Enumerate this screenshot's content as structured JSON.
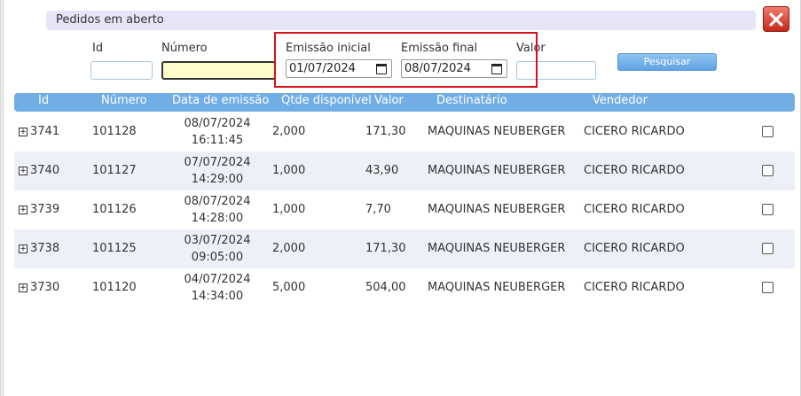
{
  "dialog": {
    "title": "Pedidos em aberto"
  },
  "filters": {
    "id_label": "Id",
    "numero_label": "Número",
    "emissao_inicial_label": "Emissão inicial",
    "emissao_inicial_value": "01/07/2024",
    "emissao_final_label": "Emissão final",
    "emissao_final_value": "08/07/2024",
    "valor_label": "Valor",
    "search_label": "Pesquisar"
  },
  "table": {
    "headers": [
      "Id",
      "Número",
      "Data de emissão",
      "Qtde disponível",
      "Valor",
      "Destinatário",
      "Vendedor"
    ],
    "rows": [
      {
        "id": "3741",
        "numero": "101128",
        "date": "08/07/2024",
        "time": "16:11:45",
        "qtde": "2,000",
        "valor": "171,30",
        "destinatario": "MAQUINAS NEUBERGER",
        "vendedor": "CICERO RICARDO"
      },
      {
        "id": "3740",
        "numero": "101127",
        "date": "07/07/2024",
        "time": "14:29:00",
        "qtde": "1,000",
        "valor": "43,90",
        "destinatario": "MAQUINAS NEUBERGER",
        "vendedor": "CICERO RICARDO"
      },
      {
        "id": "3739",
        "numero": "101126",
        "date": "08/07/2024",
        "time": "14:28:00",
        "qtde": "1,000",
        "valor": "7,70",
        "destinatario": "MAQUINAS NEUBERGER",
        "vendedor": "CICERO RICARDO"
      },
      {
        "id": "3738",
        "numero": "101125",
        "date": "03/07/2024",
        "time": "09:05:00",
        "qtde": "2,000",
        "valor": "171,30",
        "destinatario": "MAQUINAS NEUBERGER",
        "vendedor": "CICERO RICARDO"
      },
      {
        "id": "3730",
        "numero": "101120",
        "date": "04/07/2024",
        "time": "14:34:00",
        "qtde": "5,000",
        "valor": "504,00",
        "destinatario": "MAQUINAS NEUBERGER",
        "vendedor": "CICERO RICARDO"
      }
    ]
  },
  "colors": {
    "header_bg": "#72aee6",
    "highlight": "#d4101a",
    "alt_row": "#eef0f7"
  }
}
